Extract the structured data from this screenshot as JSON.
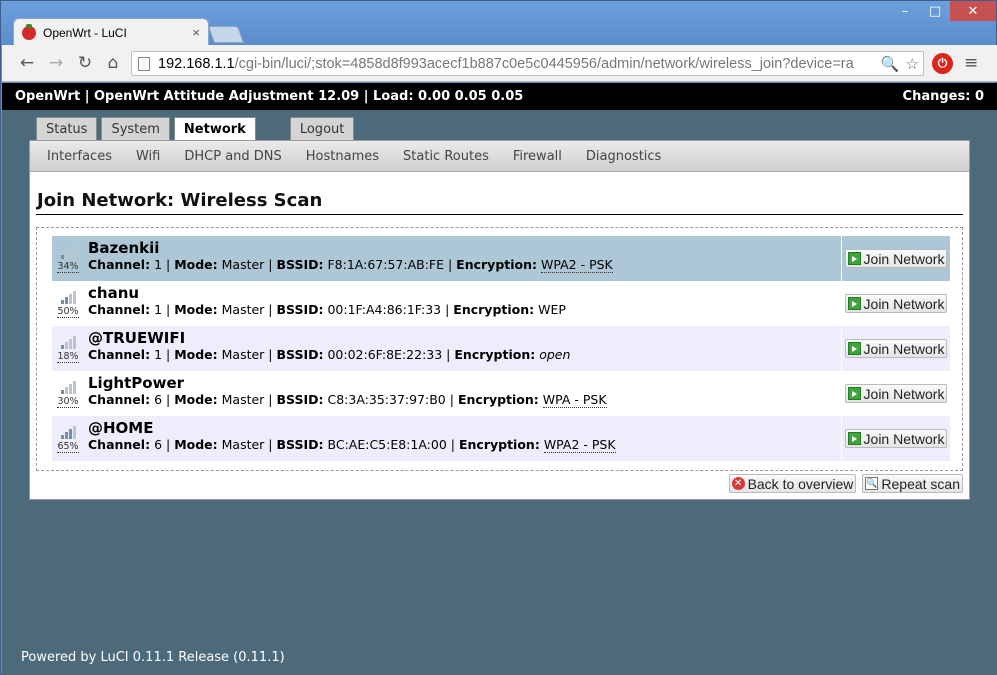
{
  "browser": {
    "tab_title": "OpenWrt - LuCI",
    "tab_close": "×",
    "url_host": "192.168.1.1",
    "url_path": "/cgi-bin/luci/;stok=4858d8f993acecf1b887c0e5c0445956/admin/network/wireless_join?device=ra",
    "win_min": "–",
    "win_max": "□",
    "win_close": "✕",
    "back_glyph": "←",
    "forward_glyph": "→",
    "reload_glyph": "↻",
    "home_glyph": "⌂",
    "zoom_glyph": "🔍",
    "star_glyph": "☆",
    "menu_glyph": "≡"
  },
  "header": {
    "left": "OpenWrt | OpenWrt Attitude Adjustment 12.09 | Load: 0.00 0.05 0.05",
    "changes": "Changes: 0"
  },
  "main_tabs": [
    "Status",
    "System",
    "Network",
    "Logout"
  ],
  "subnav": [
    "Interfaces",
    "Wifi",
    "DHCP and DNS",
    "Hostnames",
    "Static Routes",
    "Firewall",
    "Diagnostics"
  ],
  "page_title": "Join Network: Wireless Scan",
  "labels": {
    "channel": "Channel:",
    "mode": "Mode:",
    "bssid": "BSSID:",
    "encryption": "Encryption:",
    "join": "Join Network"
  },
  "networks": [
    {
      "ssid": "Bazenkii",
      "signal": "34%",
      "level": 0.34,
      "channel": "1",
      "mode": "Master",
      "bssid": "F8:1A:67:57:AB:FE",
      "encryption": "WPA2 - PSK"
    },
    {
      "ssid": "chanu",
      "signal": "50%",
      "level": 0.5,
      "channel": "1",
      "mode": "Master",
      "bssid": "00:1F:A4:86:1F:33",
      "encryption": "WEP"
    },
    {
      "ssid": "@TRUEWIFI",
      "signal": "18%",
      "level": 0.18,
      "channel": "1",
      "mode": "Master",
      "bssid": "00:02:6F:8E:22:33",
      "encryption": "open"
    },
    {
      "ssid": "LightPower",
      "signal": "30%",
      "level": 0.3,
      "channel": "6",
      "mode": "Master",
      "bssid": "C8:3A:35:37:97:B0",
      "encryption": "WPA - PSK"
    },
    {
      "ssid": "@HOME",
      "signal": "65%",
      "level": 0.65,
      "channel": "6",
      "mode": "Master",
      "bssid": "BC:AE:C5:E8:1A:00",
      "encryption": "WPA2 - PSK"
    }
  ],
  "buttons": {
    "back": "Back to overview",
    "repeat": "Repeat scan"
  },
  "footer": "Powered by LuCI 0.11.1 Release (0.11.1)"
}
